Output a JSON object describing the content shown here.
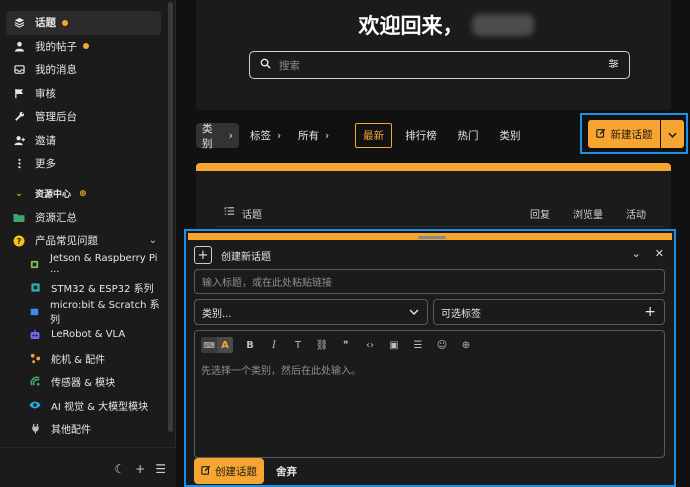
{
  "sidebar": {
    "items": [
      {
        "label": "话题",
        "icon": "layers-icon",
        "active": true,
        "dot": true
      },
      {
        "label": "我的帖子",
        "icon": "user-icon",
        "dot": true
      },
      {
        "label": "我的消息",
        "icon": "inbox-icon"
      },
      {
        "label": "审核",
        "icon": "flag-icon"
      },
      {
        "label": "管理后台",
        "icon": "wrench-icon"
      },
      {
        "label": "邀请",
        "icon": "invite-icon"
      },
      {
        "label": "更多",
        "icon": "more-icon"
      }
    ],
    "section_label": "资源中心",
    "resource_items": [
      {
        "label": "资源汇总",
        "icon": "folder-icon"
      },
      {
        "label": "产品常见问题",
        "icon": "question-icon"
      }
    ],
    "sub_items": [
      {
        "label": "Jetson & Raspberry Pi ...",
        "icon": "chip-icon"
      },
      {
        "label": "STM32 & ESP32 系列",
        "icon": "board-icon"
      },
      {
        "label": "micro:bit & Scratch 系列",
        "icon": "puzzle-icon"
      },
      {
        "label": "LeRobot & VLA",
        "icon": "robot-icon"
      },
      {
        "label": "舵机 & 配件",
        "icon": "servo-icon"
      },
      {
        "label": "传感器 & 模块",
        "icon": "sensor-icon"
      },
      {
        "label": "AI 视觉 & 大模型模块",
        "icon": "eye-icon"
      },
      {
        "label": "其他配件",
        "icon": "plug-icon"
      }
    ],
    "footer_icons": [
      "moon-icon",
      "plus-icon",
      "menu-icon"
    ],
    "footer_glyphs": {
      "moon": "☾",
      "plus": "+",
      "menu": "☰"
    }
  },
  "hero": {
    "title": "欢迎回来，"
  },
  "search": {
    "placeholder": "搜索"
  },
  "nav": {
    "filters": [
      {
        "label": "类别"
      },
      {
        "label": "标签"
      },
      {
        "label": "所有"
      }
    ],
    "tabs": [
      {
        "label": "最新",
        "active": true
      },
      {
        "label": "排行榜"
      },
      {
        "label": "热门"
      },
      {
        "label": "类别"
      }
    ],
    "new_topic_label": "新建话题"
  },
  "topic_list": {
    "headers": {
      "topic": "话题",
      "replies": "回复",
      "views": "浏览量",
      "activity": "活动"
    }
  },
  "composer": {
    "title": "创建新话题",
    "title_placeholder": "输入标题，或在此处粘贴链接",
    "category_placeholder": "类别...",
    "tags_placeholder": "可选标签",
    "editor_placeholder": "先选择一个类别，然后在此处输入。",
    "toolbar": [
      "bold-icon",
      "italic-icon",
      "heading-icon",
      "link-icon",
      "quote-icon",
      "code-icon",
      "image-icon",
      "list-icon",
      "emoji-icon",
      "add-icon"
    ],
    "create_label": "创建话题",
    "discard_label": "舍弃"
  },
  "colors": {
    "accent": "#f7a531",
    "focus": "#1e90e6",
    "background": "#111111",
    "panel": "#1b1b1b"
  }
}
